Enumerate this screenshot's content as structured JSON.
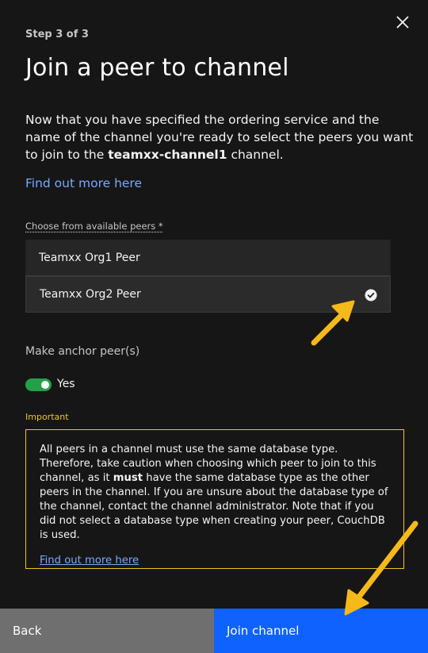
{
  "header": {
    "step": "Step 3 of 3",
    "title": "Join a peer to channel"
  },
  "description": {
    "text_before": "Now that you have specified the ordering service and the name of the channel you're ready to select the peers you want to join to the ",
    "channel_name": "teamxx-channel1",
    "text_after": " channel.",
    "link": "Find out more here"
  },
  "peers": {
    "label": "Choose from available peers *",
    "items": [
      {
        "name": "Teamxx Org1 Peer",
        "selected": false
      },
      {
        "name": "Teamxx Org2 Peer",
        "selected": true
      }
    ]
  },
  "anchor": {
    "label": "Make anchor peer(s)",
    "toggle_text": "Yes",
    "on": true
  },
  "notice": {
    "heading": "Important",
    "text_before": "All peers in a channel must use the same database type. Therefore, take caution when choosing which peer to join to this channel, as it ",
    "emphasis": "must",
    "text_after": " have the same database type as the other peers in the channel. If you are unsure about the database type of the channel, contact the channel administrator. Note that if you did not select a database type when creating your peer, CouchDB is used.",
    "link": "Find out more here"
  },
  "footer": {
    "back_label": "Back",
    "join_label": "Join channel"
  },
  "colors": {
    "background": "#161616",
    "link": "#78a9ff",
    "warning": "#f1c21b",
    "toggle_on": "#24a148",
    "primary_button": "#0f62fe",
    "secondary_button": "#6f6f6f",
    "annotation_arrow": "#f5b91a"
  },
  "icons": {
    "close": "close-icon",
    "check": "checkmark-filled-icon"
  }
}
